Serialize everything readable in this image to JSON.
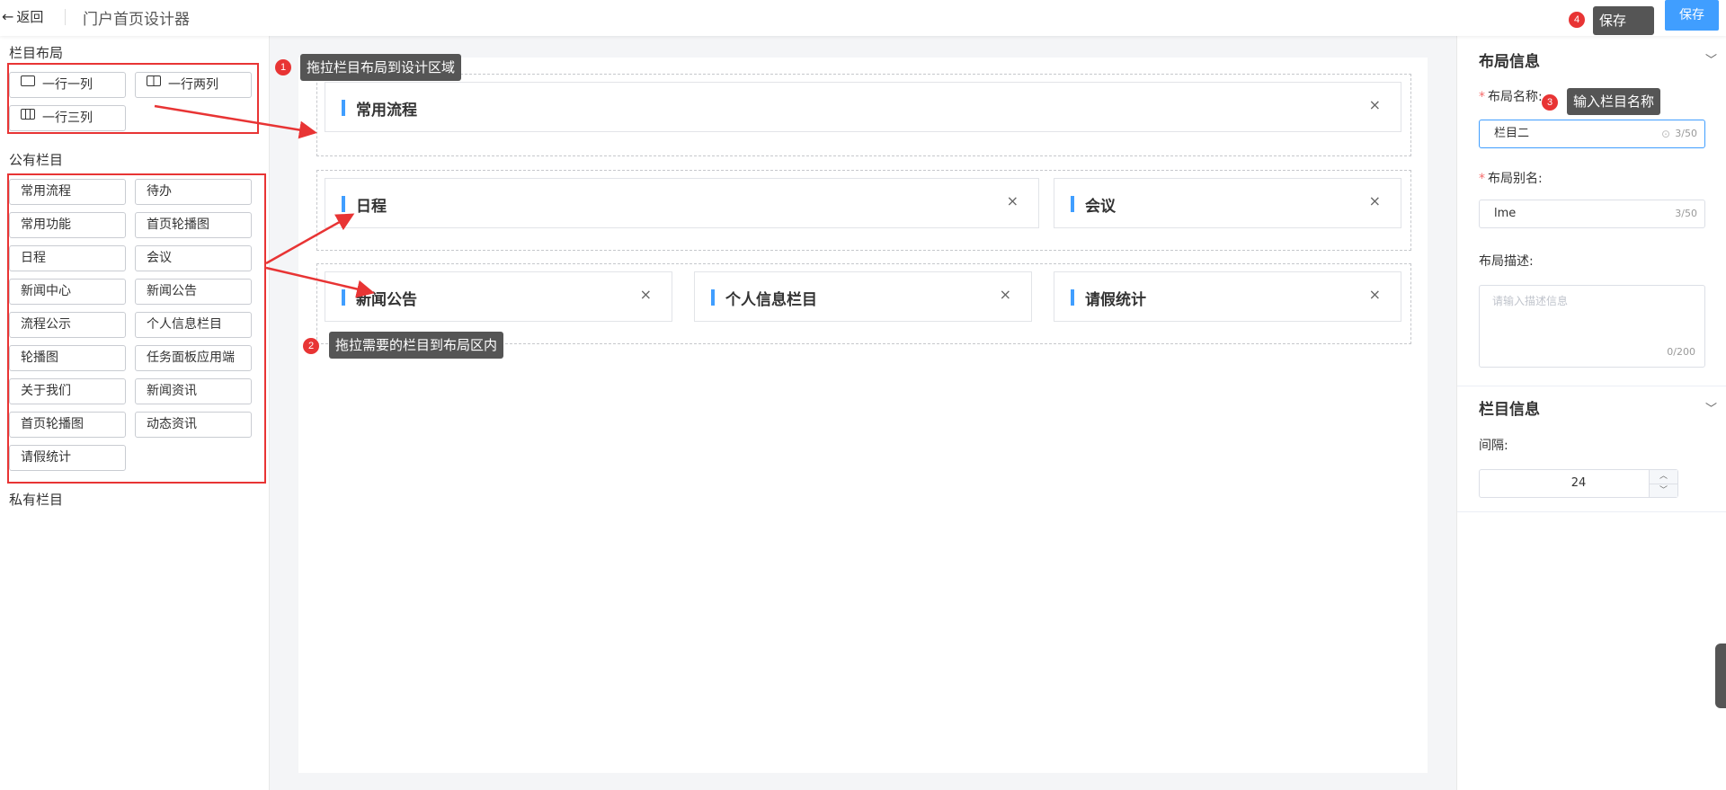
{
  "header": {
    "back_label": "返回",
    "title": "门户首页设计器",
    "save_label": "保存"
  },
  "annotations": {
    "a1": {
      "num": "1",
      "text": "拖拉栏目布局到设计区域"
    },
    "a2": {
      "num": "2",
      "text": "拖拉需要的栏目到布局区内"
    },
    "a3": {
      "num": "3",
      "text": "输入栏目名称"
    },
    "a4": {
      "num": "4",
      "text": "保存"
    }
  },
  "left": {
    "layout_title": "栏目布局",
    "layouts": [
      "一行一列",
      "一行两列",
      "一行三列"
    ],
    "public_title": "公有栏目",
    "public_items": [
      "常用流程",
      "待办",
      "常用功能",
      "首页轮播图",
      "日程",
      "会议",
      "新闻中心",
      "新闻公告",
      "流程公示",
      "个人信息栏目",
      "轮播图",
      "任务面板应用端",
      "关于我们",
      "新闻资讯",
      "首页轮播图",
      "动态资讯",
      "请假统计"
    ],
    "private_title": "私有栏目"
  },
  "canvas": {
    "rows": [
      {
        "columns": [
          "常用流程"
        ]
      },
      {
        "columns": [
          "日程",
          "会议"
        ]
      },
      {
        "columns": [
          "新闻公告",
          "个人信息栏目",
          "请假统计"
        ]
      }
    ],
    "close_glyph": "×"
  },
  "right": {
    "layout_info_title": "布局信息",
    "name_label": "布局名称:",
    "name_value": "栏目二",
    "name_count": "3/50",
    "alias_label": "布局别名:",
    "alias_value": "lme",
    "alias_count": "3/50",
    "desc_label": "布局描述:",
    "desc_placeholder": "请输入描述信息",
    "desc_count": "0/200",
    "column_info_title": "栏目信息",
    "gap_label": "间隔:",
    "gap_value": "24"
  },
  "colors": {
    "accent": "#409eff",
    "annotation_red": "#e83434",
    "tooltip_bg": "#555555"
  }
}
